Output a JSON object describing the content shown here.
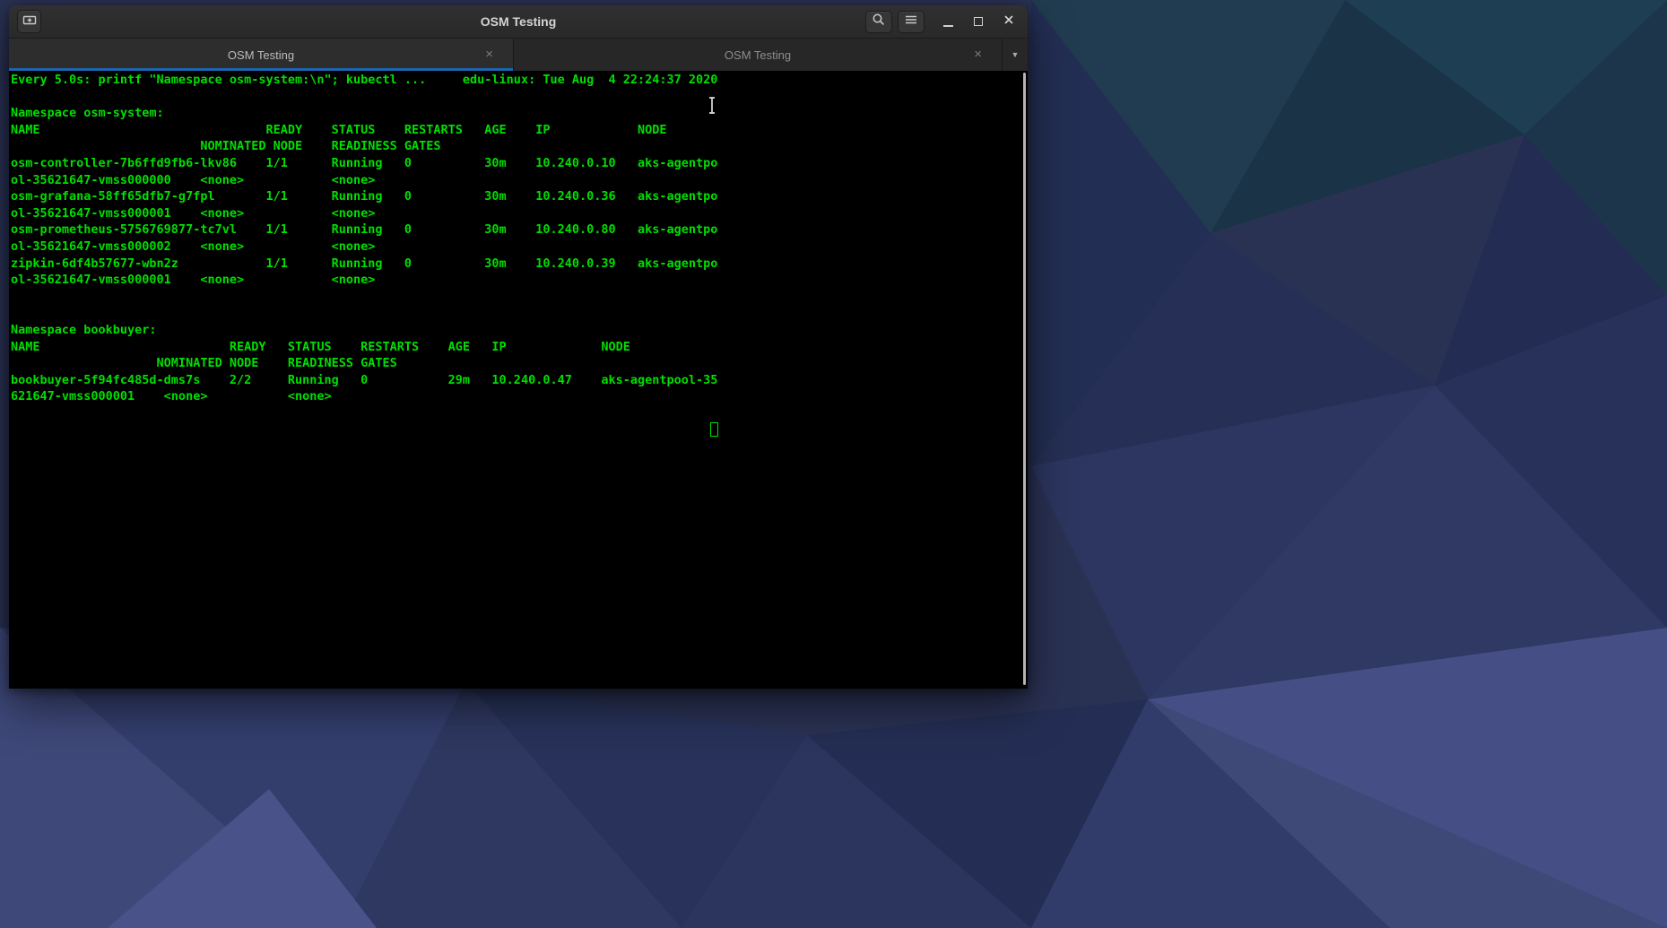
{
  "theme": {
    "desktop_base": "#2a3254",
    "titlebar_bg": "#303030",
    "tabbar_bg": "#232323",
    "tab_active_bg": "#2d2d2d",
    "tab_inactive_bg": "#272727",
    "accent_blue": "#1b65ad",
    "terminal_bg": "#000000",
    "terminal_green": "#00df00",
    "title_fg": "#d4d4d4",
    "tab_active_fg": "#bcbcbc",
    "tab_inactive_fg": "#8d8d8d",
    "icon_fg": "#cccccc"
  },
  "window": {
    "title": "OSM Testing"
  },
  "icons": {
    "new_tab": "tab-new-icon",
    "search": "search-icon",
    "menu": "hamburger-menu-icon",
    "minimize": "minimize-icon",
    "maximize": "maximize-icon",
    "close": "close-icon",
    "dropdown": "chevron-down-icon"
  },
  "tabs": {
    "items": [
      {
        "label": "OSM Testing",
        "active": true,
        "close_glyph": "×"
      },
      {
        "label": "OSM Testing",
        "active": false,
        "close_glyph": "×"
      }
    ],
    "overflow_glyph": "▼"
  },
  "terminal": {
    "cursor": {
      "line_index": 21,
      "column": 96
    },
    "lines": [
      "Every 5.0s: printf \"Namespace osm-system:\\n\"; kubectl ...     edu-linux: Tue Aug  4 22:24:37 2020",
      "",
      "Namespace osm-system:",
      "NAME                               READY    STATUS    RESTARTS   AGE    IP            NODE",
      "                          NOMINATED NODE    READINESS GATES",
      "osm-controller-7b6ffd9fb6-lkv86    1/1      Running   0          30m    10.240.0.10   aks-agentpo",
      "ol-35621647-vmss000000    <none>            <none>",
      "osm-grafana-58ff65dfb7-g7fpl       1/1      Running   0          30m    10.240.0.36   aks-agentpo",
      "ol-35621647-vmss000001    <none>            <none>",
      "osm-prometheus-5756769877-tc7vl    1/1      Running   0          30m    10.240.0.80   aks-agentpo",
      "ol-35621647-vmss000002    <none>            <none>",
      "zipkin-6df4b57677-wbn2z            1/1      Running   0          30m    10.240.0.39   aks-agentpo",
      "ol-35621647-vmss000001    <none>            <none>",
      "",
      "",
      "Namespace bookbuyer:",
      "NAME                          READY   STATUS    RESTARTS    AGE   IP             NODE",
      "                    NOMINATED NODE    READINESS GATES",
      "bookbuyer-5f94fc485d-dms7s    2/2     Running   0           29m   10.240.0.47    aks-agentpool-35",
      "621647-vmss000001    <none>           <none>",
      "",
      ""
    ]
  }
}
